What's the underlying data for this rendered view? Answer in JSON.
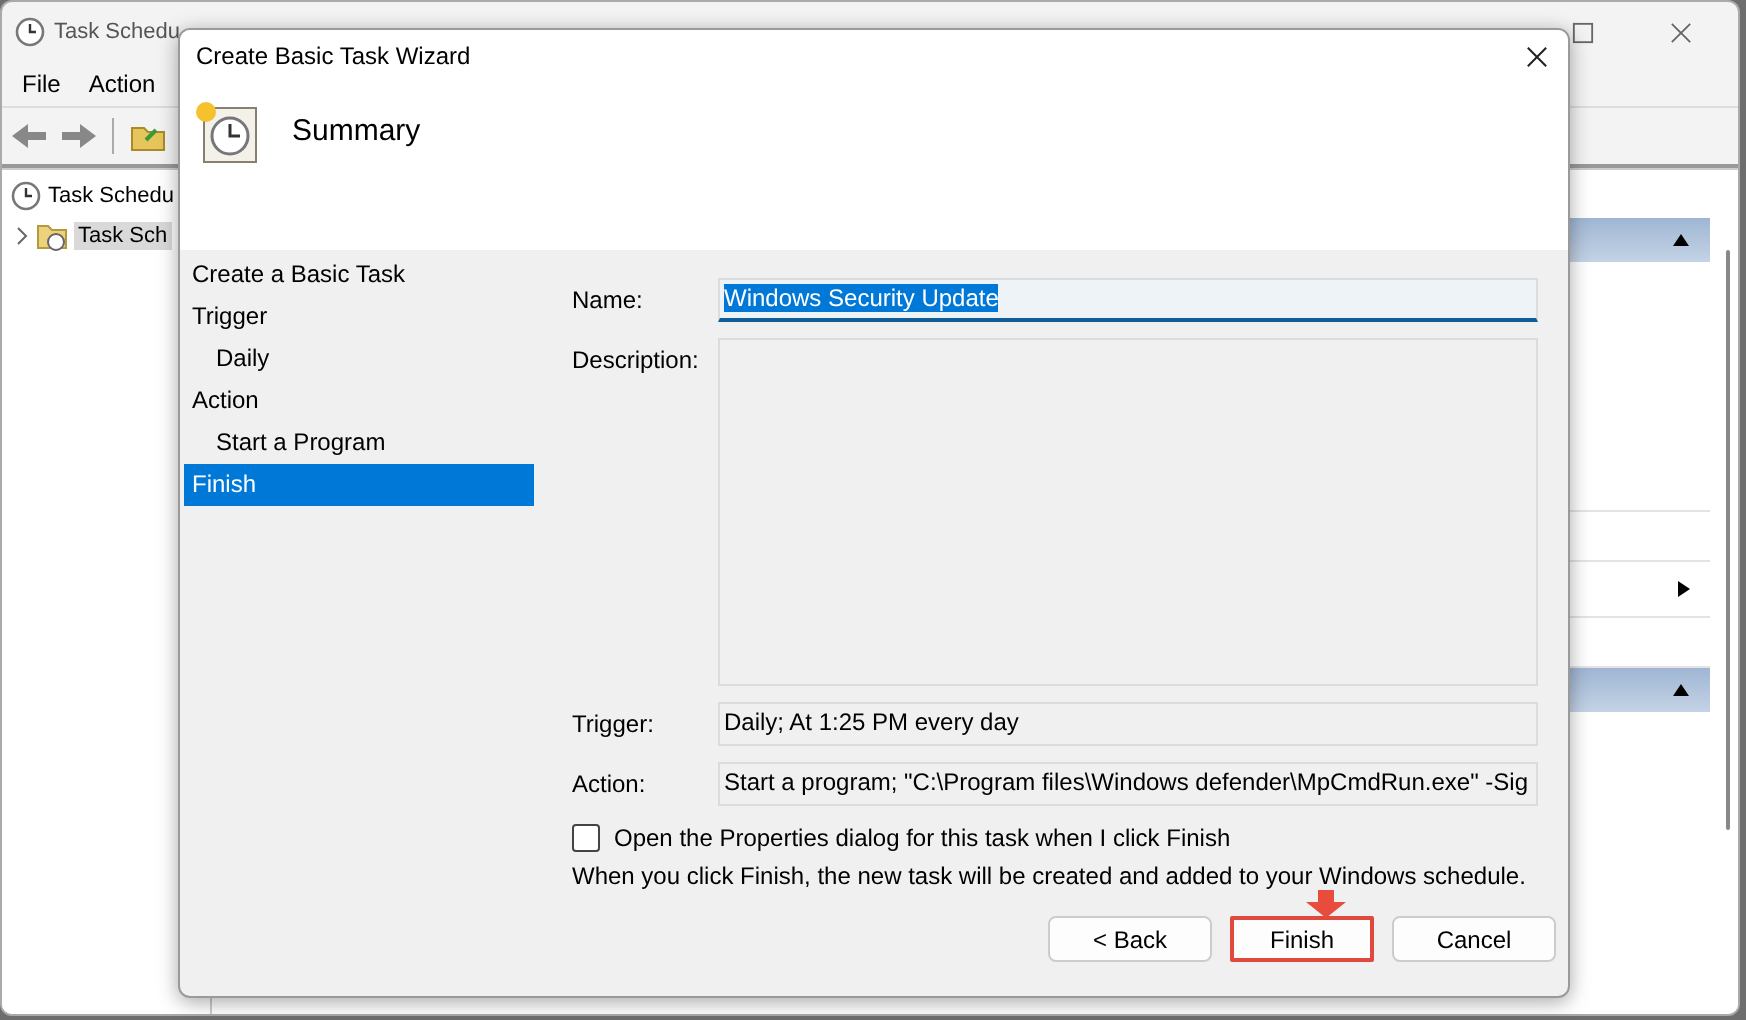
{
  "background_window": {
    "title": "Task Schedu",
    "menu": [
      "File",
      "Action"
    ],
    "tree": [
      {
        "label": "Task Schedu",
        "selected": false,
        "children": [
          {
            "label": "Task Sch",
            "selected": true
          }
        ]
      }
    ]
  },
  "dialog": {
    "title": "Create Basic Task Wizard",
    "heading": "Summary",
    "steps": [
      {
        "label": "Create a Basic Task",
        "selected": false
      },
      {
        "label": "Trigger",
        "selected": false,
        "children": [
          {
            "label": "Daily",
            "selected": false
          }
        ]
      },
      {
        "label": "Action",
        "selected": false,
        "children": [
          {
            "label": "Start a Program",
            "selected": false
          }
        ]
      },
      {
        "label": "Finish",
        "selected": true
      }
    ],
    "fields": [
      {
        "kind": "input",
        "label": "Name:",
        "value": "Windows Security Update",
        "text_selected": true
      },
      {
        "kind": "area",
        "label": "Description:"
      },
      {
        "kind": "readonly",
        "label": "Trigger:",
        "value": "Daily; At 1:25 PM every day"
      },
      {
        "kind": "readonly",
        "label": "Action:",
        "value": "Start a program; \"C:\\Program files\\Windows defender\\MpCmdRun.exe\" -Sig"
      }
    ],
    "checkbox": {
      "label": "Open the Properties dialog for this task when I click Finish",
      "checked": false
    },
    "note": "When you click Finish, the new task will be created and added to your Windows schedule.",
    "buttons": [
      {
        "label": "< Back",
        "highlighted": false
      },
      {
        "label": "Finish",
        "highlighted": true
      },
      {
        "label": "Cancel",
        "highlighted": false
      }
    ]
  }
}
